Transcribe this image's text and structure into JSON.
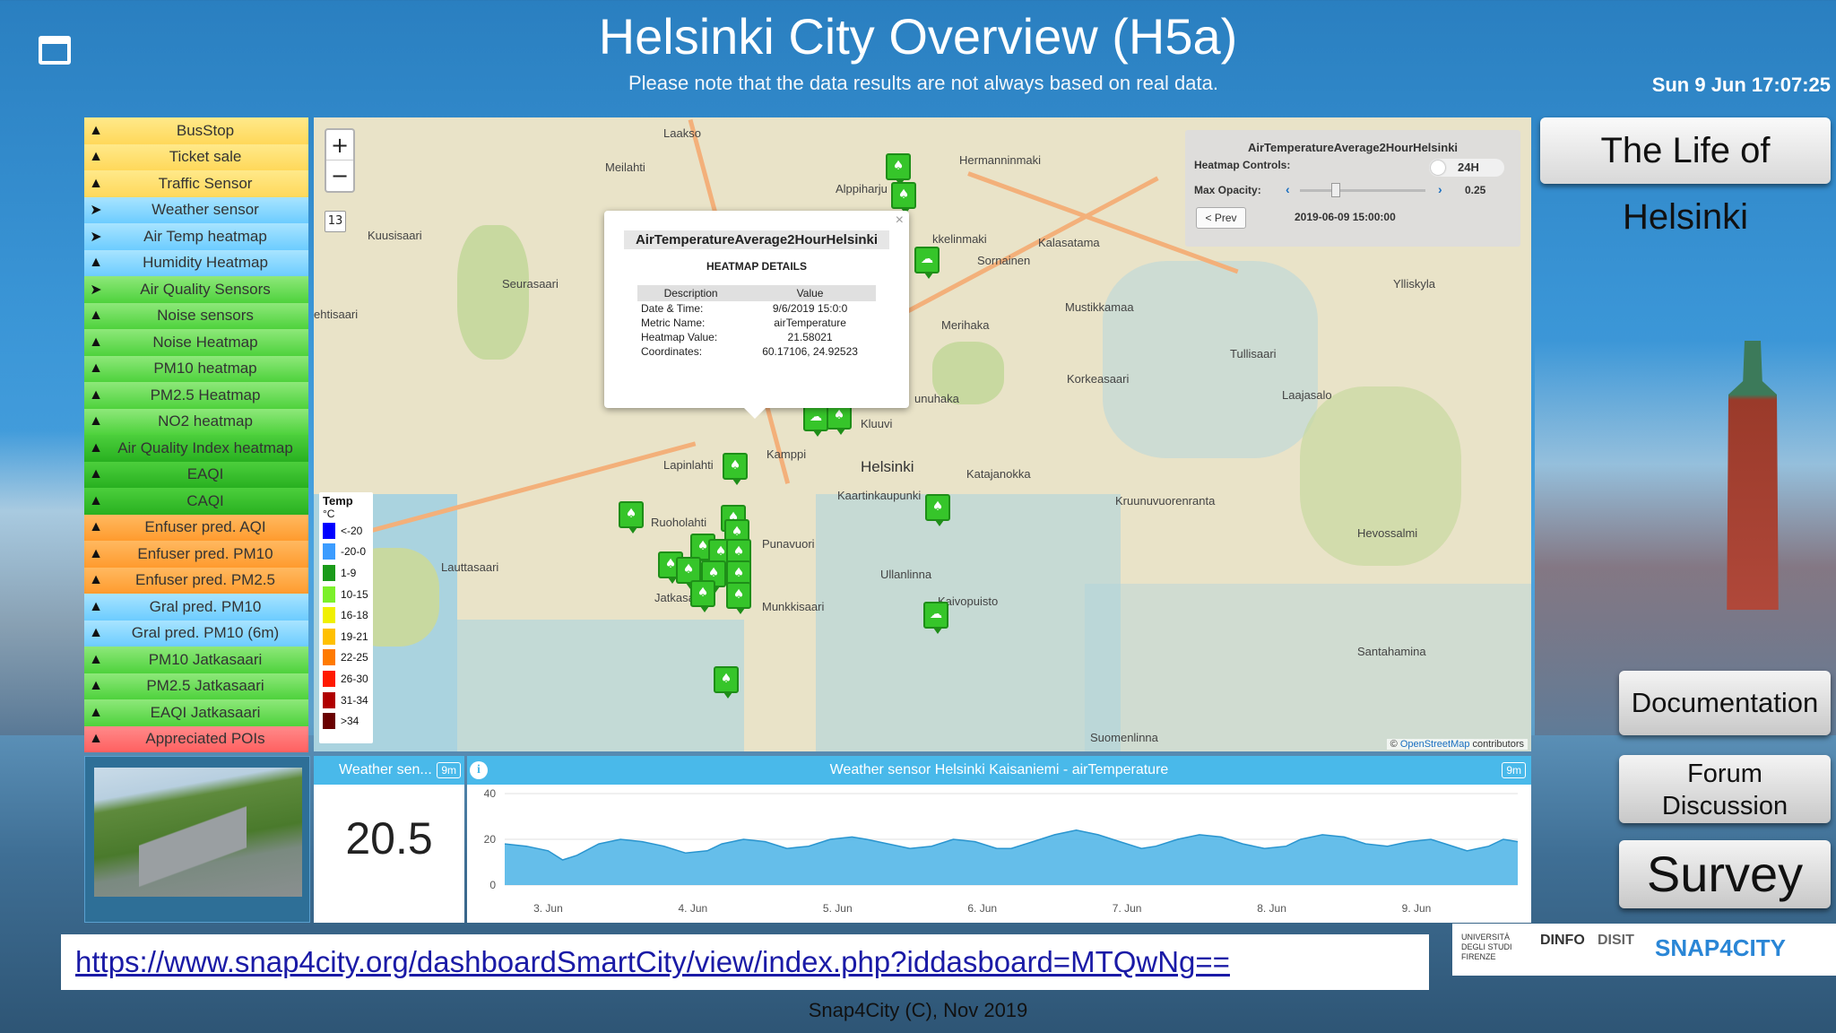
{
  "header": {
    "title": "Helsinki City Overview (H5a)",
    "subtitle": "Please note that the data results are not always based on real data.",
    "clock": "Sun 9 Jun 17:07:25"
  },
  "sidebar": {
    "items": [
      {
        "label": "BusStop",
        "color": "yellow"
      },
      {
        "label": "Ticket sale",
        "color": "yellow"
      },
      {
        "label": "Traffic Sensor",
        "color": "yellow"
      },
      {
        "label": "Weather sensor",
        "color": "blue"
      },
      {
        "label": "Air Temp heatmap",
        "color": "blue"
      },
      {
        "label": "Humidity Heatmap",
        "color": "blue"
      },
      {
        "label": "Air Quality Sensors",
        "color": "green"
      },
      {
        "label": "Noise sensors",
        "color": "green"
      },
      {
        "label": "Noise Heatmap",
        "color": "green"
      },
      {
        "label": "PM10 heatmap",
        "color": "green"
      },
      {
        "label": "PM2.5 Heatmap",
        "color": "green"
      },
      {
        "label": "NO2 heatmap",
        "color": "green"
      },
      {
        "label": "Air Quality Index heatmap",
        "color": "dgreen"
      },
      {
        "label": "EAQI",
        "color": "dgreen"
      },
      {
        "label": "CAQI",
        "color": "dgreen"
      },
      {
        "label": "Enfuser pred. AQI",
        "color": "orange"
      },
      {
        "label": "Enfuser pred. PM10",
        "color": "orange"
      },
      {
        "label": "Enfuser pred. PM2.5",
        "color": "orange"
      },
      {
        "label": "Gral pred. PM10",
        "color": "blue"
      },
      {
        "label": "Gral pred. PM10 (6m)",
        "color": "blue"
      },
      {
        "label": "PM10 Jatkasaari",
        "color": "green"
      },
      {
        "label": "PM2.5 Jatkasaari",
        "color": "green"
      },
      {
        "label": "EAQI Jatkasaari",
        "color": "green"
      },
      {
        "label": "Appreciated POIs",
        "color": "red"
      }
    ]
  },
  "map": {
    "zoom_in": "+",
    "zoom_out": "−",
    "zoom_level": "13",
    "labels": [
      "Laakso",
      "Meilahti",
      "Alppiharju",
      "Hermanninmaki",
      "Kalasatama",
      "Kuusisaari",
      "Sornainen",
      "Mustikkamaa",
      "Merihaka",
      "Korkeasaari",
      "Tullisaari",
      "Laajasalo",
      "Ylliskyla",
      "ehtisaari",
      "Seurasaari",
      "Kluuvi",
      "Kamppi",
      "Helsinki",
      "Lapinlahti",
      "Katajanokka",
      "Kaartinkaupunki",
      "Kruunuvuorenranta",
      "Ruoholahti",
      "Punavuori",
      "Lauttasaari",
      "Ullanlinna",
      "Hevossalmi",
      "Jatkasaari",
      "Munkkisaari",
      "Kaivopuisto",
      "Santahamina",
      "Suomenlinna",
      "unuhaka",
      "kkelinmaki"
    ],
    "popup": {
      "title": "AirTemperatureAverage2HourHelsinki",
      "subtitle": "HEATMAP DETAILS",
      "close": "×",
      "col_desc": "Description",
      "col_value": "Value",
      "rows": [
        {
          "desc": "Date & Time:",
          "value": "9/6/2019 15:0:0"
        },
        {
          "desc": "Metric Name:",
          "value": "airTemperature"
        },
        {
          "desc": "Heatmap Value:",
          "value": "21.58021"
        },
        {
          "desc": "Coordinates:",
          "value": "60.17106, 24.92523"
        }
      ]
    },
    "heatmap_controls": {
      "title": "AirTemperatureAverage2HourHelsinki",
      "controls_label": "Heatmap Controls:",
      "toggle_label": "24H",
      "opacity_label": "Max Opacity:",
      "opacity_value": "0.25",
      "opacity_fraction": 0.25,
      "prev_label": "< Prev",
      "date": "2019-06-09 15:00:00"
    },
    "legend": {
      "title": "Temp",
      "unit": "°C",
      "items": [
        {
          "label": "<-20",
          "color": "#0000ff"
        },
        {
          "label": "-20-0",
          "color": "#3c9cff"
        },
        {
          "label": "1-9",
          "color": "#1a9a1a"
        },
        {
          "label": "10-15",
          "color": "#7cf02a"
        },
        {
          "label": "16-18",
          "color": "#f0f000"
        },
        {
          "label": "19-21",
          "color": "#ffc000"
        },
        {
          "label": "22-25",
          "color": "#ff7a00"
        },
        {
          "label": "26-30",
          "color": "#ff1a00"
        },
        {
          "label": "31-34",
          "color": "#b00000"
        },
        {
          "label": ">34",
          "color": "#6a0000"
        }
      ]
    },
    "attribution_prefix": "© ",
    "attribution_link": "OpenStreetMap",
    "attribution_suffix": " contributors"
  },
  "right_buttons": {
    "life": "The Life of Helsinki",
    "documentation": "Documentation",
    "forum_line1": "Forum",
    "forum_line2": "Discussion",
    "survey": "Survey"
  },
  "weather_widget": {
    "header": "Weather sen...",
    "badge": "9m",
    "value": "20.5"
  },
  "chart_widget": {
    "title": "Weather sensor Helsinki Kaisaniemi - airTemperature",
    "badge": "9m",
    "info": "i"
  },
  "chart_data": {
    "type": "area",
    "title": "Weather sensor Helsinki Kaisaniemi - airTemperature",
    "xlabel": "",
    "ylabel": "",
    "ylim": [
      0,
      40
    ],
    "yticks": [
      "0",
      "20",
      "40"
    ],
    "xticks": [
      "3. Jun",
      "4. Jun",
      "5. Jun",
      "6. Jun",
      "7. Jun",
      "8. Jun",
      "9. Jun"
    ],
    "xlim_days": [
      2.7,
      9.7
    ],
    "grid": true,
    "color": "#4ab3e6",
    "series": [
      {
        "x": [
          2.7,
          2.85,
          3.0,
          3.1,
          3.2,
          3.35,
          3.5,
          3.65,
          3.8,
          3.95,
          4.1,
          4.2,
          4.35,
          4.5,
          4.65,
          4.8,
          4.95,
          5.1,
          5.2,
          5.35,
          5.5,
          5.65,
          5.8,
          5.95,
          6.1,
          6.2,
          6.35,
          6.5,
          6.65,
          6.8,
          6.95,
          7.1,
          7.2,
          7.35,
          7.5,
          7.65,
          7.8,
          7.95,
          8.1,
          8.2,
          8.35,
          8.5,
          8.65,
          8.8,
          8.95,
          9.1,
          9.2,
          9.35,
          9.5,
          9.6,
          9.7
        ],
        "values": [
          18,
          17,
          15,
          11,
          13,
          18,
          20,
          19,
          17,
          14,
          15,
          18,
          20,
          19,
          16,
          17,
          20,
          21,
          20,
          18,
          16,
          17,
          20,
          19,
          16,
          16,
          19,
          22,
          24,
          22,
          19,
          16,
          17,
          20,
          22,
          21,
          18,
          16,
          17,
          20,
          22,
          21,
          18,
          17,
          19,
          20,
          18,
          15,
          17,
          20,
          19
        ]
      }
    ]
  },
  "url": "https://www.snap4city.org/dashboardSmartCity/view/index.php?iddasboard=MTQwNg==",
  "logos": {
    "unifi": "UNIVERSITÀ DEGLI STUDI FIRENZE",
    "dinfo": "DINFO",
    "disit": "DISIT",
    "snap4city": "SNAP4CITY"
  },
  "footer": "Snap4City (C), Nov 2019"
}
